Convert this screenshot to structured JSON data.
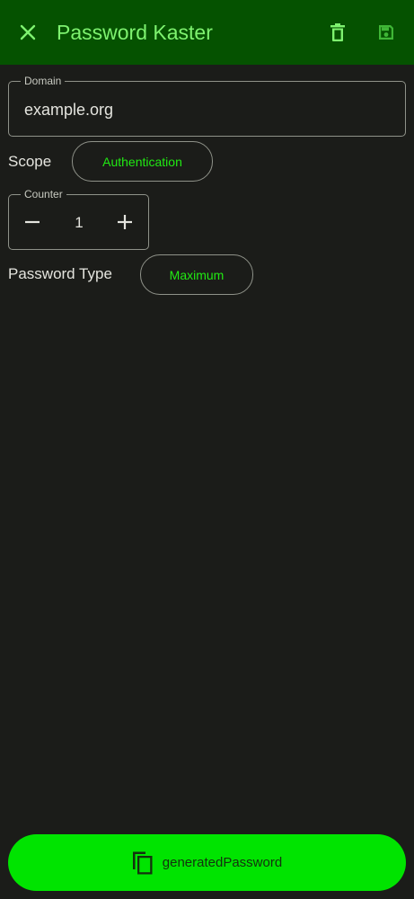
{
  "app": {
    "title": "Password Kaster",
    "colors": {
      "toolbar": "#055200",
      "background": "#1b1c19",
      "accent": "#21ea13",
      "primary_button": "#00e400"
    }
  },
  "toolbar": {
    "close_icon": "close-icon",
    "delete_icon": "delete-icon",
    "save_icon": "save-icon"
  },
  "domain": {
    "label": "Domain",
    "value": "example.org"
  },
  "scope": {
    "label": "Scope",
    "selected": "Authentication"
  },
  "counter": {
    "label": "Counter",
    "value": "1"
  },
  "password_type": {
    "label": "Password Type",
    "selected": "Maximum"
  },
  "copy_button": {
    "icon": "copy-icon",
    "label": "generatedPassword"
  }
}
